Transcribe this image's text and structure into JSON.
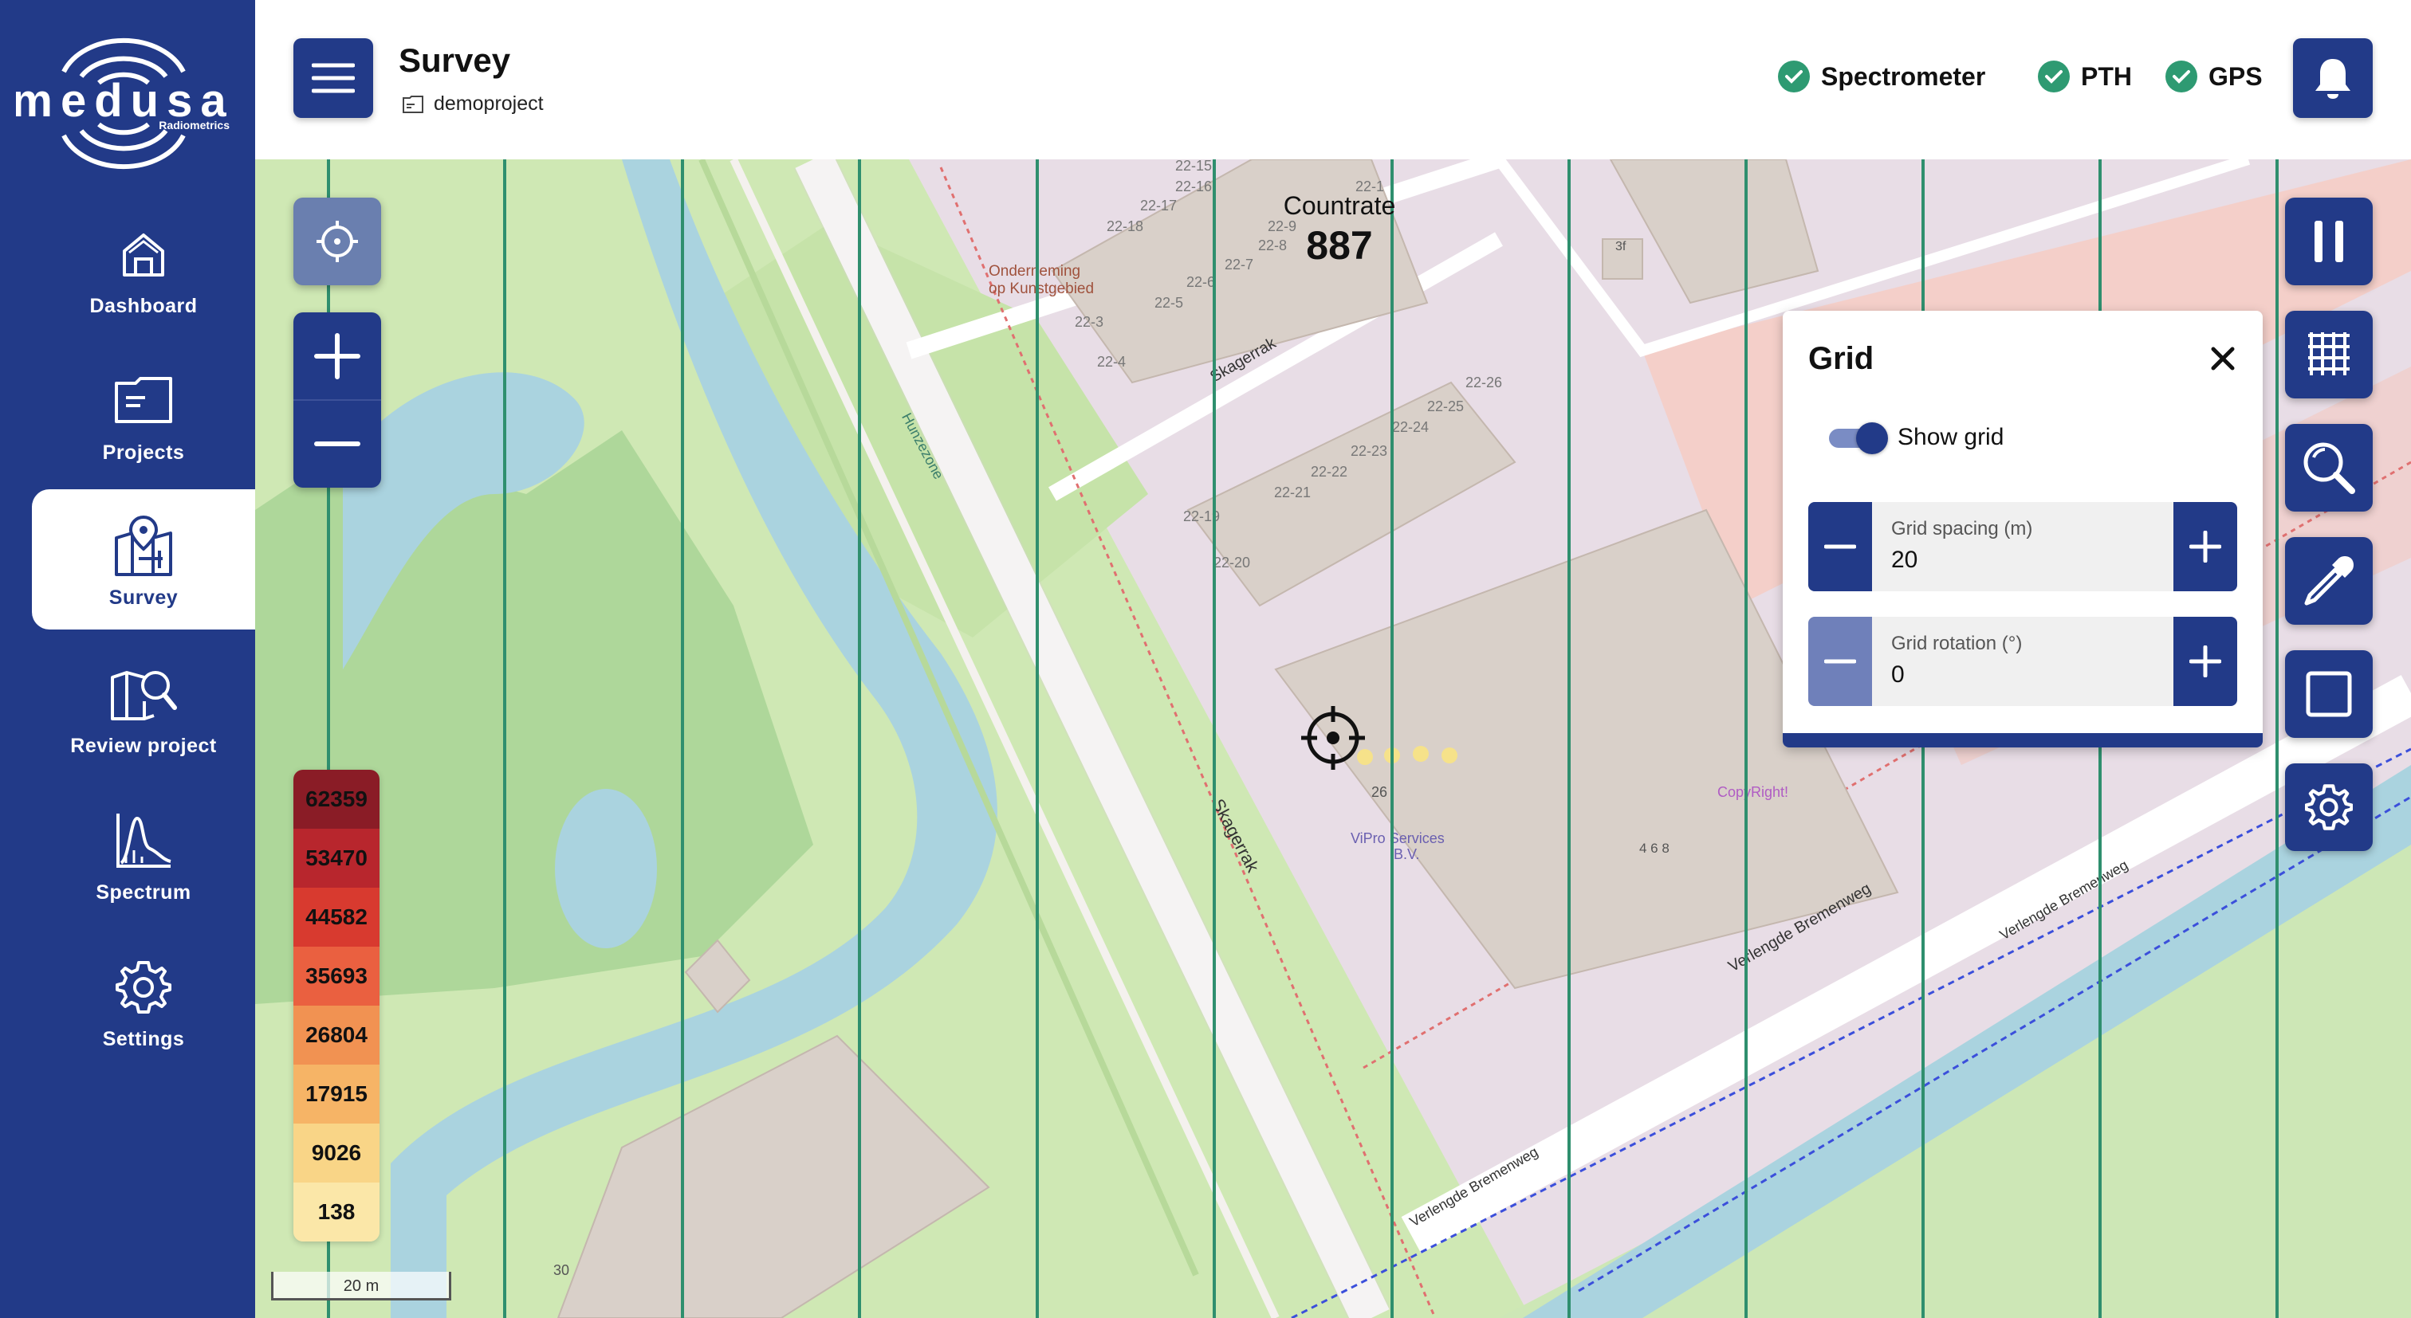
{
  "app": {
    "logo_text": "medusa",
    "logo_subtext": "Radiometrics"
  },
  "sidebar": {
    "items": [
      {
        "label": "Dashboard",
        "icon": "house-icon"
      },
      {
        "label": "Projects",
        "icon": "folder-icon"
      },
      {
        "label": "Survey",
        "icon": "map-pin-icon",
        "active": true
      },
      {
        "label": "Review project",
        "icon": "map-search-icon"
      },
      {
        "label": "Spectrum",
        "icon": "spectrum-chart-icon"
      },
      {
        "label": "Settings",
        "icon": "gear-icon"
      }
    ]
  },
  "header": {
    "title": "Survey",
    "project": "demoproject",
    "statuses": [
      {
        "label": "Spectrometer",
        "ok": true
      },
      {
        "label": "PTH",
        "ok": true
      },
      {
        "label": "GPS",
        "ok": true
      }
    ]
  },
  "map": {
    "countrate_label": "Countrate",
    "countrate_value": "887",
    "scale_label": "20 m",
    "labels": {
      "skagerrak": "Skagerrak",
      "hunzezone": "Hunzezone",
      "verlengde": "Verlengde Bremenweg",
      "poi_onderneming_1": "Onderneming",
      "poi_onderneming_2": "op Kunstgebied",
      "poi_vipro_1": "ViPro Services",
      "poi_vipro_2": "B.V.",
      "poi_copyright": "CopyRight!",
      "num_26": "26",
      "num_30": "30",
      "num_3f": "3f",
      "num_468": "4 6 8",
      "h_2215": "22-15",
      "h_2216": "22-16",
      "h_2217": "22-17",
      "h_2218": "22-18",
      "h_229": "22-9",
      "h_228": "22-8",
      "h_227": "22-7",
      "h_226": "22-6",
      "h_225": "22-5",
      "h_223": "22-3",
      "h_224": "22-4",
      "h_221": "22-1",
      "h_2226": "22-26",
      "h_2225": "22-25",
      "h_2224": "22-24",
      "h_2223": "22-23",
      "h_2222": "22-22",
      "h_2221": "22-21",
      "h_2219": "22-19",
      "h_2220": "22-20"
    }
  },
  "legend": {
    "values": [
      "62359",
      "53470",
      "44582",
      "35693",
      "26804",
      "17915",
      "9026",
      "138"
    ],
    "colors": [
      "#8a1c26",
      "#b8262d",
      "#d83a2f",
      "#ea6040",
      "#f19252",
      "#f6b466",
      "#f9d587",
      "#fbe7a8"
    ]
  },
  "grid_panel": {
    "title": "Grid",
    "show_grid_label": "Show grid",
    "show_grid": true,
    "spacing_label": "Grid spacing (m)",
    "spacing_value": "20",
    "rotation_label": "Grid rotation (°)",
    "rotation_value": "0"
  },
  "colors": {
    "brand": "#223a88",
    "success": "#2e9a72",
    "grid_line": "#2f8f6e"
  }
}
